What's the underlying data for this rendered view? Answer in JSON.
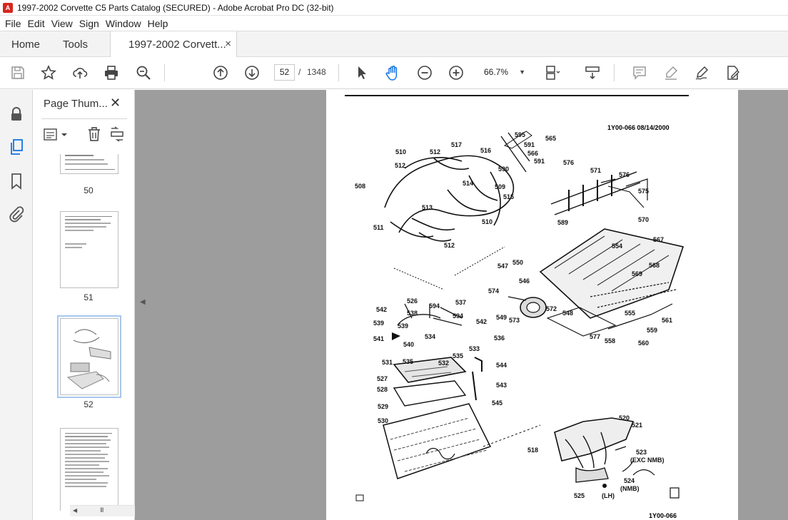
{
  "window": {
    "title": "1997-2002 Corvette C5 Parts Catalog (SECURED) - Adobe Acrobat Pro DC (32-bit)",
    "app_icon": "acrobat-icon"
  },
  "menu": [
    "File",
    "Edit",
    "View",
    "Sign",
    "Window",
    "Help"
  ],
  "tabs": {
    "home": "Home",
    "tools": "Tools",
    "document": "1997-2002 Corvett...",
    "close": "×"
  },
  "toolbar": {
    "current_page": "52",
    "separator": "/",
    "total_pages": "1348",
    "zoom": "66.7%",
    "icons": [
      "save-icon",
      "bookmark-star-icon",
      "upload-icon",
      "print-icon",
      "search-zoom-icon",
      "prev-page-icon",
      "next-page-icon",
      "select-cursor-icon",
      "hand-tool-icon",
      "zoom-out-icon",
      "zoom-in-icon",
      "page-layout-icon",
      "scroll-mode-icon",
      "comment-icon",
      "highlight-icon",
      "sign-icon",
      "fill-sign-icon"
    ]
  },
  "rail": [
    "lock-icon",
    "pages-icon",
    "bookmark-icon",
    "attachment-icon"
  ],
  "panel": {
    "title": "Page Thum...",
    "close": "✕",
    "thumbnails": [
      {
        "label": "50",
        "selected": false
      },
      {
        "label": "51",
        "selected": false
      },
      {
        "label": "52",
        "selected": true
      },
      {
        "label": "",
        "selected": false
      }
    ],
    "scroll_grip": "III"
  },
  "document": {
    "header": "1Y00-066  08/14/2000",
    "footer": "1Y00-066",
    "callouts": [
      "595",
      "565",
      "591",
      "566",
      "591",
      "510",
      "512",
      "517",
      "516",
      "590",
      "512",
      "508",
      "509",
      "514",
      "515",
      "576",
      "571",
      "576",
      "575",
      "513",
      "511",
      "510",
      "512",
      "589",
      "570",
      "567",
      "554",
      "568",
      "547",
      "550",
      "569",
      "546",
      "526",
      "537",
      "574",
      "542",
      "538",
      "594",
      "594",
      "542",
      "539",
      "539",
      "572",
      "549",
      "573",
      "548",
      "555",
      "561",
      "541",
      "540",
      "534",
      "536",
      "559",
      "577",
      "558",
      "560",
      "533",
      "535",
      "531",
      "535",
      "532",
      "544",
      "527",
      "528",
      "543",
      "545",
      "529",
      "530",
      "520",
      "521",
      "518",
      "523",
      "(EXC NMB)",
      "524",
      "(NMB)",
      "525",
      "(LH)"
    ]
  }
}
